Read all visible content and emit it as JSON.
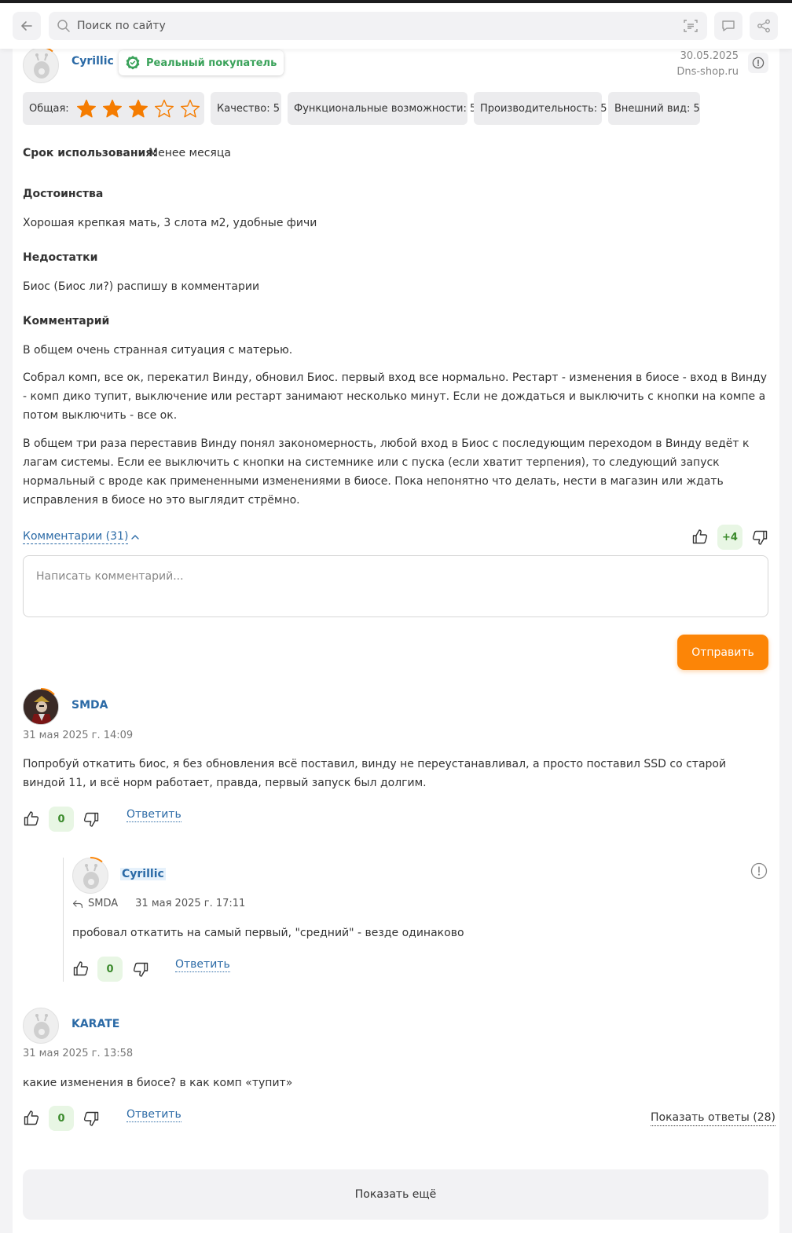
{
  "search": {
    "placeholder": "Поиск по сайту"
  },
  "review": {
    "author": "Cyrillic",
    "buyer_badge": "Реальный покупатель",
    "date": "30.05.2025",
    "source": "Dns-shop.ru",
    "overall_label": "Общая:",
    "overall_rating": 3,
    "overall_max": 5,
    "ratings": [
      "Качество: 5",
      "Функциональные возможности: 5",
      "Производительность: 5",
      "Внешний вид: 5"
    ],
    "usage_label": "Срок использования:",
    "usage_value": "Менее месяца",
    "pros_title": "Достоинства",
    "pros_text": "Хорошая крепкая мать, 3 слота м2, удобные фичи",
    "cons_title": "Недостатки",
    "cons_text": "Биос (Биос ли?) распишу в комментарии",
    "comment_title": "Комментарий",
    "comment_paragraphs": [
      "В общем очень странная ситуация с матерью.",
      "Собрал комп, все ок, перекатил Винду, обновил Биос. первый вход все нормально. Рестарт - изменения в биосе - вход в Винду - комп дико тупит, выключение или рестарт занимают несколько минут. Если не дождаться и выключить с кнопки на компе а потом выключить - все ок.",
      "В общем три раза переставив Винду понял закономерность, любой вход в Биос с последующим переходом в Винду ведёт к лагам системы. Если ее выключить с кнопки на системнике или с пуска (если хватит терпения), то следующий запуск нормальный с вроде как примененными изменениями в биосе. Пока непонятно что делать, нести в магазин или ждать исправления в биосе но это выглядит стрёмно."
    ],
    "comments_link": "Комментарии (31)",
    "votes": "+4"
  },
  "comment_form": {
    "placeholder": "Написать комментарий...",
    "submit": "Отправить"
  },
  "comments": [
    {
      "author": "SMDA",
      "date": "31 мая 2025 г. 14:09",
      "text": "Попробуй откатить биос, я без обновления всё поставил, винду не переустанавливал, а просто поставил SSD со старой виндой 11, и всё норм работает, правда, первый запуск был долгим.",
      "votes": "0",
      "reply_label": "Ответить",
      "replies": [
        {
          "author": "Cyrillic",
          "reply_to": "SMDA",
          "date": "31 мая 2025 г. 17:11",
          "text": "пробовал откатить на самый первый, \"средний\" - везде одинаково",
          "votes": "0",
          "reply_label": "Ответить"
        }
      ]
    },
    {
      "author": "KARATE",
      "date": "31 мая 2025 г. 13:58",
      "text": "какие изменения в биосе? в как комп «тупит»",
      "votes": "0",
      "reply_label": "Ответить",
      "show_replies": "Показать ответы (28)"
    }
  ],
  "show_more": "Показать ещё",
  "colors": {
    "accent_orange": "#fc8507",
    "link_blue": "#2b6aa6",
    "positive_green": "#3b8a2c",
    "star_orange": "#f57c00"
  }
}
